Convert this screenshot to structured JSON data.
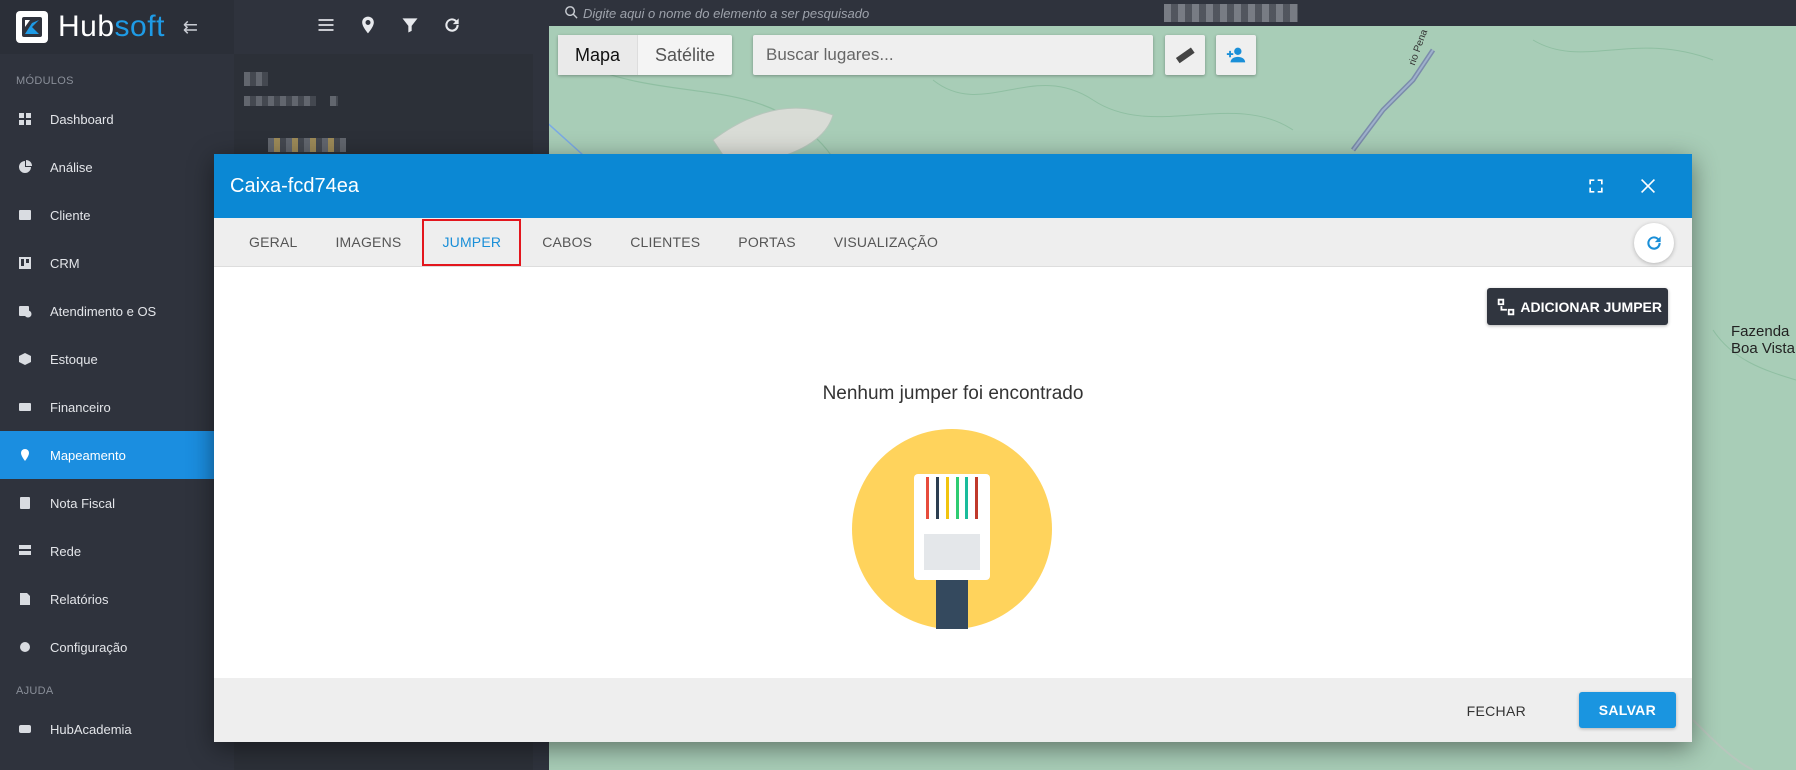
{
  "sidebar": {
    "brand": {
      "part1": "Hub",
      "part2": "soft"
    },
    "section_modules": "MÓDULOS",
    "items": [
      {
        "label": "Dashboard",
        "icon": "dashboard-icon"
      },
      {
        "label": "Análise",
        "icon": "pie-chart-icon"
      },
      {
        "label": "Cliente",
        "icon": "contact-card-icon",
        "has_children": true
      },
      {
        "label": "CRM",
        "icon": "trello-board-icon"
      },
      {
        "label": "Atendimento e OS",
        "icon": "calendar-clock-icon"
      },
      {
        "label": "Estoque",
        "icon": "box-icon"
      },
      {
        "label": "Financeiro",
        "icon": "money-icon"
      },
      {
        "label": "Mapeamento",
        "icon": "map-pin-icon",
        "active": true
      },
      {
        "label": "Nota Fiscal",
        "icon": "receipt-icon"
      },
      {
        "label": "Rede",
        "icon": "server-icon"
      },
      {
        "label": "Relatórios",
        "icon": "report-icon"
      },
      {
        "label": "Configuração",
        "icon": "gear-icon",
        "has_children": true
      }
    ],
    "section_help": "AJUDA",
    "help_items": [
      {
        "label": "HubAcademia",
        "icon": "video-icon"
      }
    ]
  },
  "map": {
    "search_placeholder": "Digite aqui o nome do elemento a ser pesquisado",
    "type_map": "Mapa",
    "type_satellite": "Satélite",
    "places_placeholder": "Buscar lugares...",
    "place_label_line1": "Fazenda",
    "place_label_line2": "Boa Vista",
    "road_label": "rio Pena"
  },
  "modal": {
    "title": "Caixa-fcd74ea",
    "tabs": [
      "GERAL",
      "IMAGENS",
      "JUMPER",
      "CABOS",
      "CLIENTES",
      "PORTAS",
      "VISUALIZAÇÃO"
    ],
    "active_tab": "JUMPER",
    "add_button": "ADICIONAR JUMPER",
    "empty_message": "Nenhum jumper foi encontrado",
    "close_button": "FECHAR",
    "save_button": "SALVAR"
  },
  "colors": {
    "primary": "#0b88d4",
    "sidebar_bg": "#2f333d",
    "active_item": "#1b8ee0",
    "tab_highlight_border": "#e3161d"
  }
}
